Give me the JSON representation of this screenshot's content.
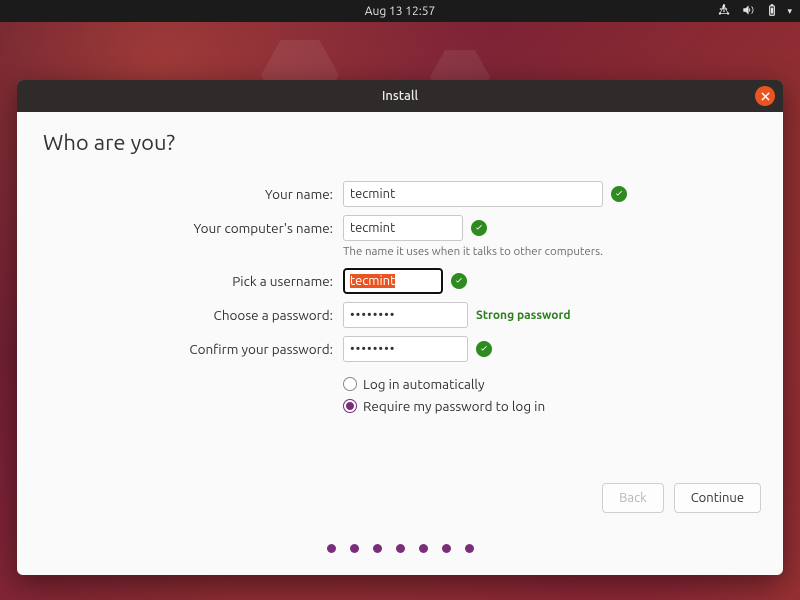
{
  "topbar": {
    "datetime": "Aug 13  12:57"
  },
  "window": {
    "title": "Install"
  },
  "heading": "Who are you?",
  "form": {
    "name": {
      "label": "Your name:",
      "value": "tecmint"
    },
    "hostname": {
      "label": "Your computer's name:",
      "value": "tecmint",
      "hint": "The name it uses when it talks to other computers."
    },
    "username": {
      "label": "Pick a username:",
      "value": "tecmint"
    },
    "password": {
      "label": "Choose a password:",
      "value": "••••••••",
      "strength": "Strong password"
    },
    "confirm": {
      "label": "Confirm your password:",
      "value": "••••••••"
    },
    "login": {
      "auto": "Log in automatically",
      "require": "Require my password to log in",
      "selected": "require"
    }
  },
  "buttons": {
    "back": "Back",
    "continue": "Continue"
  },
  "progress_dots": 7
}
